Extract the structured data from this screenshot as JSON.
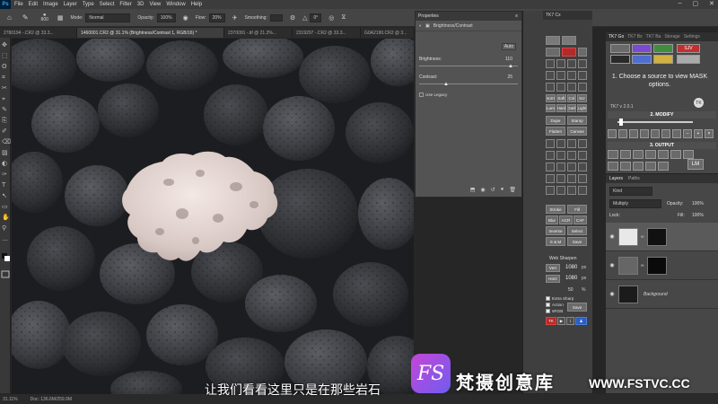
{
  "app": {
    "logo": "Ps"
  },
  "menu": [
    "File",
    "Edit",
    "Image",
    "Layer",
    "Type",
    "Select",
    "Filter",
    "3D",
    "View",
    "Window",
    "Help"
  ],
  "window_controls": [
    "–",
    "▢",
    "✕"
  ],
  "options_bar": {
    "size": "800",
    "mode_label": "Mode:",
    "mode_value": "Normal",
    "opacity_label": "Opacity:",
    "opacity_value": "100%",
    "flow_label": "Flow:",
    "flow_value": "20%",
    "smoothing_label": "Smoothing:",
    "angle_value": "0°"
  },
  "doc_tabs": [
    "2780194 -.CR2 @ 33.3...",
    "1460001.CR2 @ 31.1% (Brightness/Contrast 1, RGB/16) *",
    "2370091 -.tif @ 21.2%...",
    "2319297 -.CR2 @ 33.3...",
    "G0A2190.CR2 @ 3..."
  ],
  "properties": {
    "title": "Properties",
    "subtitle": "Brightness/Contrast",
    "auto": "Auto",
    "brightness_label": "Brightness:",
    "brightness_value": "110",
    "contrast_label": "Contrast:",
    "contrast_value": "25",
    "legacy_label": "Use Legacy"
  },
  "tk_panel": {
    "header": "TK7 Cx",
    "buttons": [
      "Norm",
      "Soft",
      "Col",
      "Scr",
      "Lum",
      "Hard",
      "Dark",
      "Light",
      "Dupe",
      "Stamp",
      "Flatten",
      "Canvas",
      "Stroke",
      "Fill",
      "Blur",
      "ACR",
      "CAF",
      "Inverse",
      "Select",
      "S & M",
      "Save",
      "Vert",
      "Horz",
      "Save"
    ],
    "web_label": "Web Sharpen",
    "vert_value": "1080",
    "horz_value": "1080",
    "unit": "px",
    "sharp_value": "50",
    "sharp_unit": "%",
    "checks": [
      "Extra Sharp",
      "Action",
      "sRGB"
    ],
    "tk_label": "TK"
  },
  "right_tabs": [
    "TK7 Go",
    "TK7 Bx",
    "TK7 Ba",
    "Storage",
    "Settings"
  ],
  "tk7": {
    "message": "1. Choose a source to view MASK options.",
    "version": "TK7 v 2.0.1",
    "modify": "2. MODIFY",
    "output": "3. OUTPUT",
    "lm": "LM",
    "sjv": "SJV"
  },
  "layers": {
    "tabs": [
      "Layers",
      "Paths"
    ],
    "filter": "Kind",
    "blend": "Multiply",
    "opacity_label": "Opacity:",
    "opacity_value": "100%",
    "lock_label": "Lock:",
    "fill_label": "Fill:",
    "fill_value": "100%",
    "background_name": "Background"
  },
  "status": {
    "zoom": "31.11%",
    "doc": "Doc: 136.6M/259.9M"
  },
  "subtitle": "让我们看看这里只是在那些岩石",
  "watermark": {
    "logo": "FS",
    "name": "梵摄创意库",
    "url": "WWW.FSTVC.CC"
  }
}
